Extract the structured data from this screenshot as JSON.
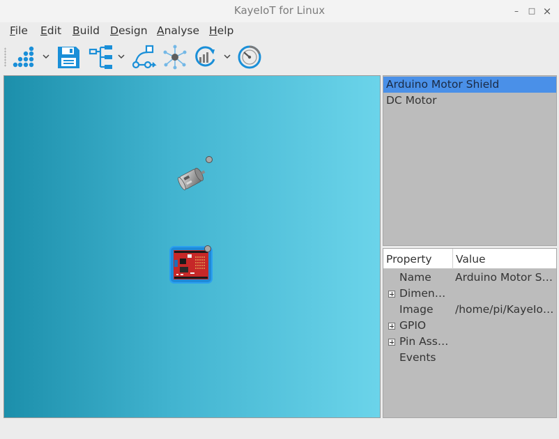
{
  "window": {
    "title": "KayeIoT for Linux",
    "minimize_glyph": "–",
    "maximize_glyph": "□",
    "close_glyph": "×"
  },
  "menu": {
    "items": [
      {
        "mnemonic": "F",
        "rest": "ile"
      },
      {
        "mnemonic": "E",
        "rest": "dit"
      },
      {
        "mnemonic": "B",
        "rest": "uild"
      },
      {
        "mnemonic": "D",
        "rest": "esign"
      },
      {
        "mnemonic": "A",
        "rest": "nalyse"
      },
      {
        "mnemonic": "H",
        "rest": "elp"
      }
    ]
  },
  "toolbar": {
    "icons": [
      "component-palette-icon",
      "save-icon",
      "hierarchy-icon",
      "connect-nodes-icon",
      "network-hub-icon",
      "analytics-refresh-icon",
      "gauge-icon"
    ],
    "accent_color": "#1a8fd8"
  },
  "canvas": {
    "gradient_left": "#1c8fab",
    "gradient_right": "#6bd4ea",
    "components": [
      {
        "name": "dc-motor"
      },
      {
        "name": "arduino-motor-shield",
        "selected": true
      }
    ]
  },
  "component_list": {
    "items": [
      {
        "label": "Arduino Motor Shield",
        "selected": true
      },
      {
        "label": "DC Motor",
        "selected": false
      }
    ],
    "selected_color": "#4a90e8"
  },
  "properties": {
    "header": {
      "property": "Property",
      "value": "Value"
    },
    "rows": [
      {
        "name": "Name",
        "value": "Arduino Motor Shi...",
        "expandable": false
      },
      {
        "name": "Dimensi...",
        "value": "",
        "expandable": true
      },
      {
        "name": "Image",
        "value": "/home/pi/KayeIoT...",
        "expandable": false
      },
      {
        "name": "GPIO",
        "value": "",
        "expandable": true
      },
      {
        "name": "Pin Assi...",
        "value": "",
        "expandable": true
      },
      {
        "name": "Events",
        "value": "",
        "expandable": false
      }
    ]
  }
}
